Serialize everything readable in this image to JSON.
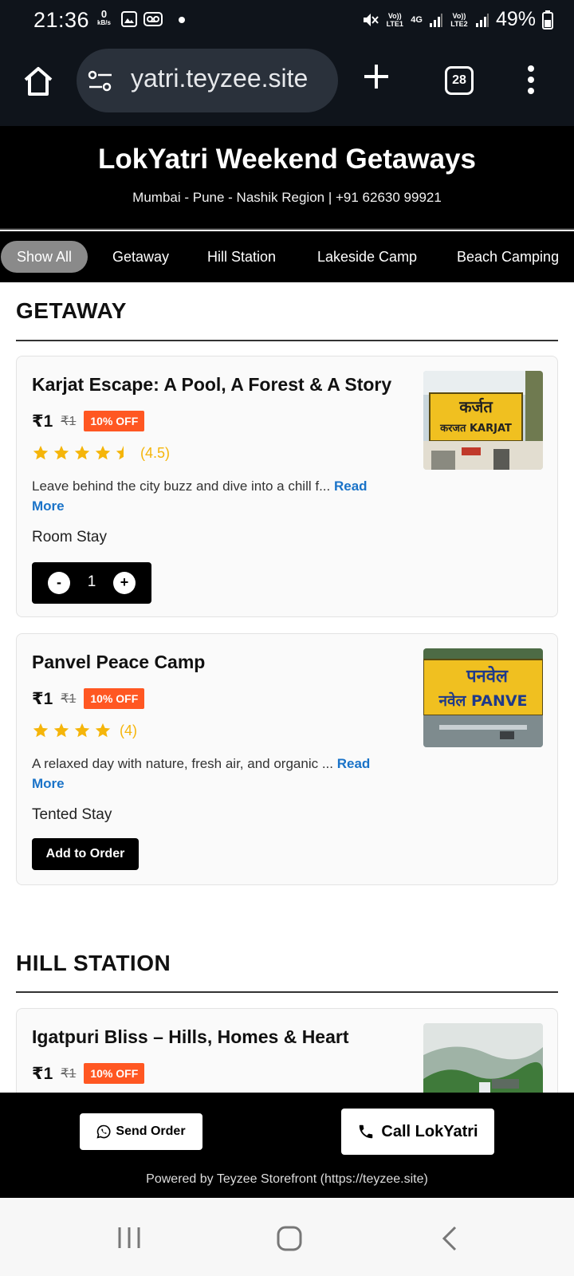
{
  "status_bar": {
    "time": "21:36",
    "net_speed_value": "0",
    "net_speed_unit": "kB/s",
    "sim1": "Vo)) LTE1",
    "sim2": "Vo)) LTE2",
    "network_type": "4G",
    "battery_percent": "49%",
    "battery_level": 0.49
  },
  "browser": {
    "url": "yatri.teyzee.site",
    "tab_count": "28"
  },
  "site": {
    "title": "LokYatri Weekend Getaways",
    "subtitle": "Mumbai - Pune - Nashik Region | +91 62630 99921"
  },
  "categories": [
    {
      "label": "Show All",
      "active": true
    },
    {
      "label": "Getaway",
      "active": false
    },
    {
      "label": "Hill Station",
      "active": false
    },
    {
      "label": "Lakeside Camp",
      "active": false
    },
    {
      "label": "Beach Camping",
      "active": false
    }
  ],
  "sections": [
    {
      "title": "GETAWAY",
      "items": [
        {
          "name": "Karjat Escape: A Pool, A Forest & A Story",
          "price": "₹1",
          "old_price": "₹1",
          "discount": "10% OFF",
          "rating": 4.5,
          "rating_text": "(4.5)",
          "description": "Leave behind the city buzz and dive into a chill f...",
          "read_more": "Read More",
          "stay_type": "Room Stay",
          "quantity": "1",
          "image_signboard": {
            "line1": "कर्जत",
            "line2": "करजत KARJAT"
          }
        },
        {
          "name": "Panvel Peace Camp",
          "price": "₹1",
          "old_price": "₹1",
          "discount": "10% OFF",
          "rating": 4,
          "rating_text": "(4)",
          "description": "A relaxed day with nature, fresh air, and organic ...",
          "read_more": "Read More",
          "stay_type": "Tented Stay",
          "add_label": "Add to Order",
          "image_signboard": {
            "line1": "पनवेल",
            "line2": "नवेल PANVE"
          }
        }
      ]
    },
    {
      "title": "HILL STATION",
      "items": [
        {
          "name": "Igatpuri Bliss – Hills, Homes & Heart",
          "price": "₹1",
          "old_price": "₹1",
          "discount": "10% OFF"
        }
      ]
    }
  ],
  "footer": {
    "send_order": "Send Order",
    "call": "Call LokYatri",
    "powered_by": "Powered by Teyzee Storefront (https://teyzee.site)"
  },
  "colors": {
    "discount": "#ff5722",
    "star": "#f5b50a",
    "read_more": "#1a73c8",
    "header_bg": "#000000"
  },
  "icons": {
    "home": "home-icon",
    "site_settings": "site-settings-icon",
    "new_tab": "plus-icon",
    "tabs": "tab-switcher-icon",
    "menu": "more-vert-icon",
    "whatsapp": "whatsapp-icon",
    "phone": "phone-icon"
  }
}
